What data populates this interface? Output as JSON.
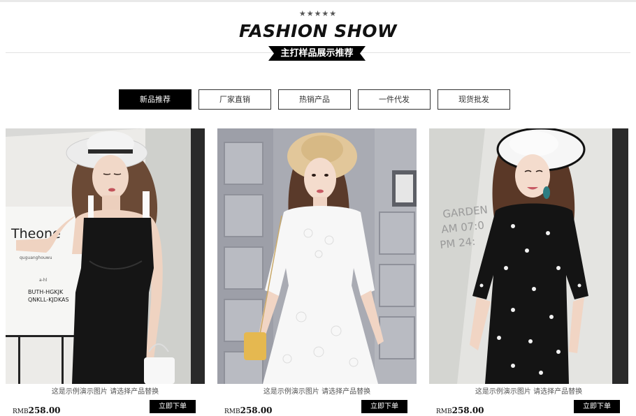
{
  "header": {
    "stars": "★★★★★",
    "title": "FASHION SHOW",
    "subtitle": "主打样品展示推荐"
  },
  "tabs": [
    {
      "label": "新品推荐",
      "active": true
    },
    {
      "label": "厂家直销",
      "active": false
    },
    {
      "label": "热销产品",
      "active": false
    },
    {
      "label": "一件代发",
      "active": false
    },
    {
      "label": "现货批发",
      "active": false
    }
  ],
  "products": [
    {
      "caption": "这是示例演示图片 请选择产品替换",
      "currency": "RMB",
      "price": "258.00",
      "buy_label": "立即下单",
      "image": "woman-black-jumpsuit-photo",
      "sign": {
        "brand": "Theone",
        "line1": "BUTH-HGKJK",
        "line2": "QNKLL-KJDKAS",
        "small": "quguanghouwu",
        "tiny": "a-hl"
      }
    },
    {
      "caption": "这是示例演示图片 请选择产品替换",
      "currency": "RMB",
      "price": "258.00",
      "buy_label": "立即下单",
      "image": "woman-white-lace-dress-photo"
    },
    {
      "caption": "这是示例演示图片 请选择产品替换",
      "currency": "RMB",
      "price": "258.00",
      "buy_label": "立即下单",
      "image": "woman-black-floral-dress-photo",
      "wall_text": {
        "line1": "GARDEN",
        "line2": "AM 07:0",
        "line3": "PM 24:"
      }
    }
  ]
}
